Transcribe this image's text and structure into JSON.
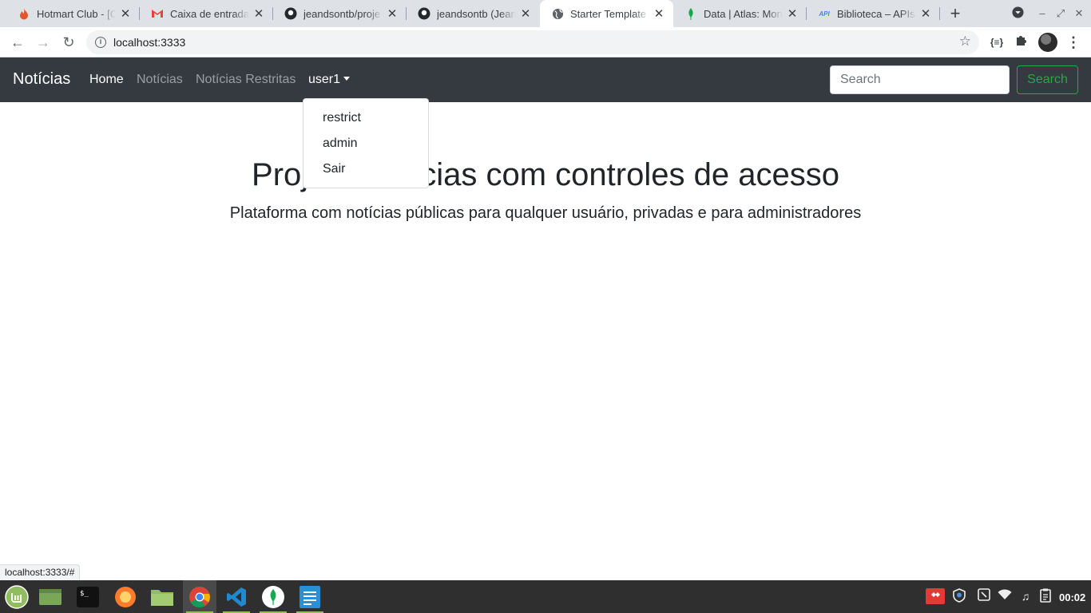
{
  "browser": {
    "tabs": [
      {
        "title": "Hotmart Club - [C",
        "icon": "flame-icon",
        "color": "#e8542a"
      },
      {
        "title": "Caixa de entrada",
        "icon": "gmail-icon",
        "color": "#ea4335"
      },
      {
        "title": "jeandsontb/proje",
        "icon": "github-icon",
        "color": "#24292e"
      },
      {
        "title": "jeandsontb (Jean",
        "icon": "github-icon",
        "color": "#24292e"
      },
      {
        "title": "Starter Template",
        "icon": "globe-icon",
        "color": "#5f6368"
      },
      {
        "title": "Data | Atlas: Mon",
        "icon": "mongodb-leaf-icon",
        "color": "#13aa52"
      },
      {
        "title": "Biblioteca – APIs",
        "icon": "api-icon",
        "color": "#4285f4"
      }
    ],
    "active_tab_index": 4,
    "url": "localhost:3333",
    "status_url": "localhost:3333/#"
  },
  "navbar": {
    "brand": "Notícias",
    "links": [
      "Home",
      "Notícias",
      "Notícias Restritas"
    ],
    "user_menu_label": "user1",
    "search_placeholder": "Search",
    "search_button": "Search",
    "colors": {
      "background": "#343a40",
      "success": "#28a745"
    }
  },
  "dropdown": {
    "items": [
      "restrict",
      "admin",
      "Sair"
    ]
  },
  "main": {
    "title": "Projeto Notícias com controles de acesso",
    "lead": "Plataforma com notícias públicas para qualquer usuário, privadas e para administradores"
  },
  "taskbar": {
    "clock": "00:02"
  }
}
